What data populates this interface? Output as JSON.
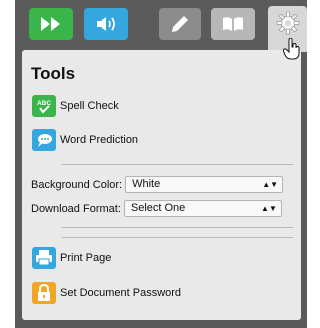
{
  "panel": {
    "title": "Tools",
    "items": [
      {
        "label": "Spell Check",
        "icon": "spell-check-icon",
        "icon_text": "ABC"
      },
      {
        "label": "Word Prediction",
        "icon": "word-prediction-icon"
      },
      {
        "label": "Print Page",
        "icon": "printer-icon"
      },
      {
        "label": "Set Document Password",
        "icon": "lock-icon"
      }
    ],
    "background_color": {
      "label": "Background Color:",
      "value": "White"
    },
    "download_format": {
      "label": "Download Format:",
      "value": "Select One"
    }
  },
  "toolbar": {
    "buttons": [
      "play-icon",
      "speaker-icon",
      "pencil-icon",
      "book-icon",
      "gear-icon"
    ]
  },
  "colors": {
    "green": "#3ab54a",
    "blue": "#34a7de",
    "orange": "#f2a627",
    "toolbar": "#5b5b5b",
    "panel": "#e9e9e9"
  }
}
